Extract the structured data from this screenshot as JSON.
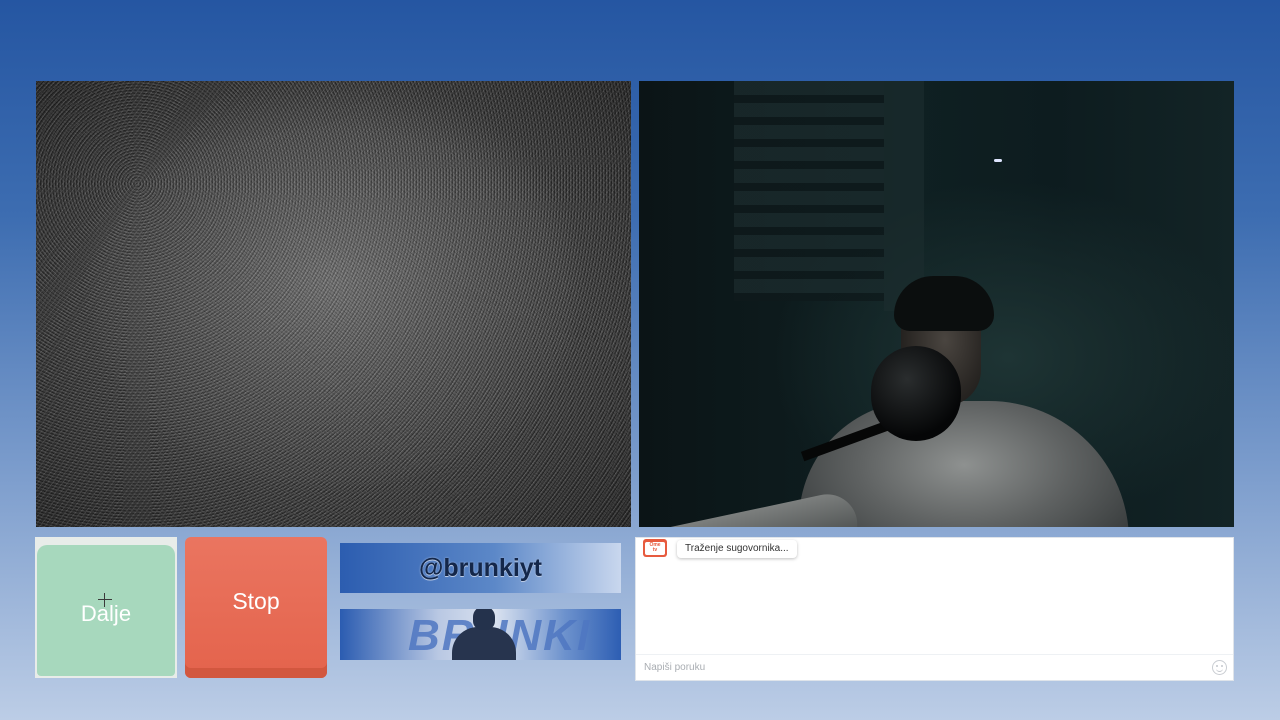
{
  "controls": {
    "next_label": "Dalje",
    "stop_label": "Stop"
  },
  "banners": {
    "handle": "@brunkiyt",
    "logo_text": "BRUNKI"
  },
  "chat": {
    "logo_line1": "Ome",
    "logo_line2": "tv",
    "status": "Traženje sugovornika...",
    "input_placeholder": "Napiši poruku"
  },
  "icons": {
    "emoji": "smiley-icon",
    "cursor": "crosshair-cursor-icon"
  },
  "colors": {
    "next_button": "#a7d8bd",
    "stop_button": "#e4634c",
    "ome_logo": "#e75b3f"
  }
}
